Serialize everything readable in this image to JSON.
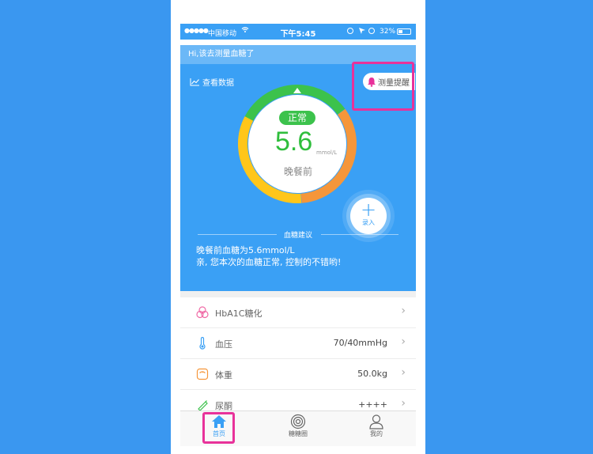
{
  "statusbar": {
    "signal": "●●●●●",
    "carrier": "中国移动",
    "time": "下午5:45",
    "battery": "32%"
  },
  "greeting": "Hi,该去测量血糖了",
  "header": {
    "view_data": "查看数据",
    "remind": "测量提醒"
  },
  "reading": {
    "status": "正常",
    "value": "5.6",
    "unit": "mmol/L",
    "meal": "晚餐前"
  },
  "add_label": "录入",
  "advice": {
    "title": "血糖建议",
    "line1": "晚餐前血糖为5.6mmol/L",
    "line2": "亲, 您本次的血糖正常, 控制的不错哟!"
  },
  "list": [
    {
      "label": "HbA1C糖化",
      "value": "",
      "icon": "hba1c-icon"
    },
    {
      "label": "血压",
      "value": "70/40mmHg",
      "icon": "thermometer-icon"
    },
    {
      "label": "体重",
      "value": "50.0kg",
      "icon": "scale-icon"
    },
    {
      "label": "尿酮",
      "value": "++++",
      "icon": "test-strip-icon"
    }
  ],
  "tabs": [
    {
      "label": "首页",
      "icon": "home-icon"
    },
    {
      "label": "糖糖圈",
      "icon": "circle-icon"
    },
    {
      "label": "我的",
      "icon": "user-icon"
    }
  ],
  "colors": {
    "background": "#3a97f0",
    "primary": "#3aa0f5",
    "normal_green": "#3cc24c",
    "gauge_yellow": "#ffc61a",
    "gauge_orange": "#f5963a",
    "highlight": "#e8329a"
  }
}
